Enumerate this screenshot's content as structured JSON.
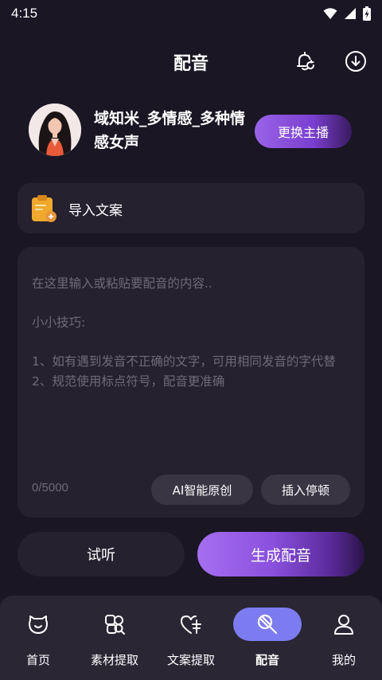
{
  "status_bar": {
    "time": "4:15"
  },
  "header": {
    "title": "配音",
    "bell_icon": "bell-refresh-icon",
    "download_icon": "download-circle-icon"
  },
  "voice": {
    "name": "域知米_多情感_多种情感女声",
    "change_label": "更换主播"
  },
  "import": {
    "label": "导入文案",
    "icon": "clipboard-icon"
  },
  "editor": {
    "placeholder_line1": "在这里输入或粘贴要配音的内容..",
    "tips_title": "小小技巧:",
    "tip1": "1、如有遇到发音不正确的文字，可用相同发音的字代替",
    "tip2": "2、规范使用标点符号，配音更准确",
    "char_count": "0/5000",
    "ai_label": "AI智能原创",
    "pause_label": "插入停顿"
  },
  "actions": {
    "listen_label": "试听",
    "generate_label": "生成配音"
  },
  "tabs": [
    {
      "label": "首页",
      "icon": "home-face-icon"
    },
    {
      "label": "素材提取",
      "icon": "material-extract-icon"
    },
    {
      "label": "文案提取",
      "icon": "text-extract-icon"
    },
    {
      "label": "配音",
      "icon": "dubbing-icon"
    },
    {
      "label": "我的",
      "icon": "profile-icon"
    }
  ],
  "colors": {
    "background": "#1a1624",
    "card": "#26212f",
    "accent": "#8a50de",
    "active_tab": "#7c7cf0"
  }
}
